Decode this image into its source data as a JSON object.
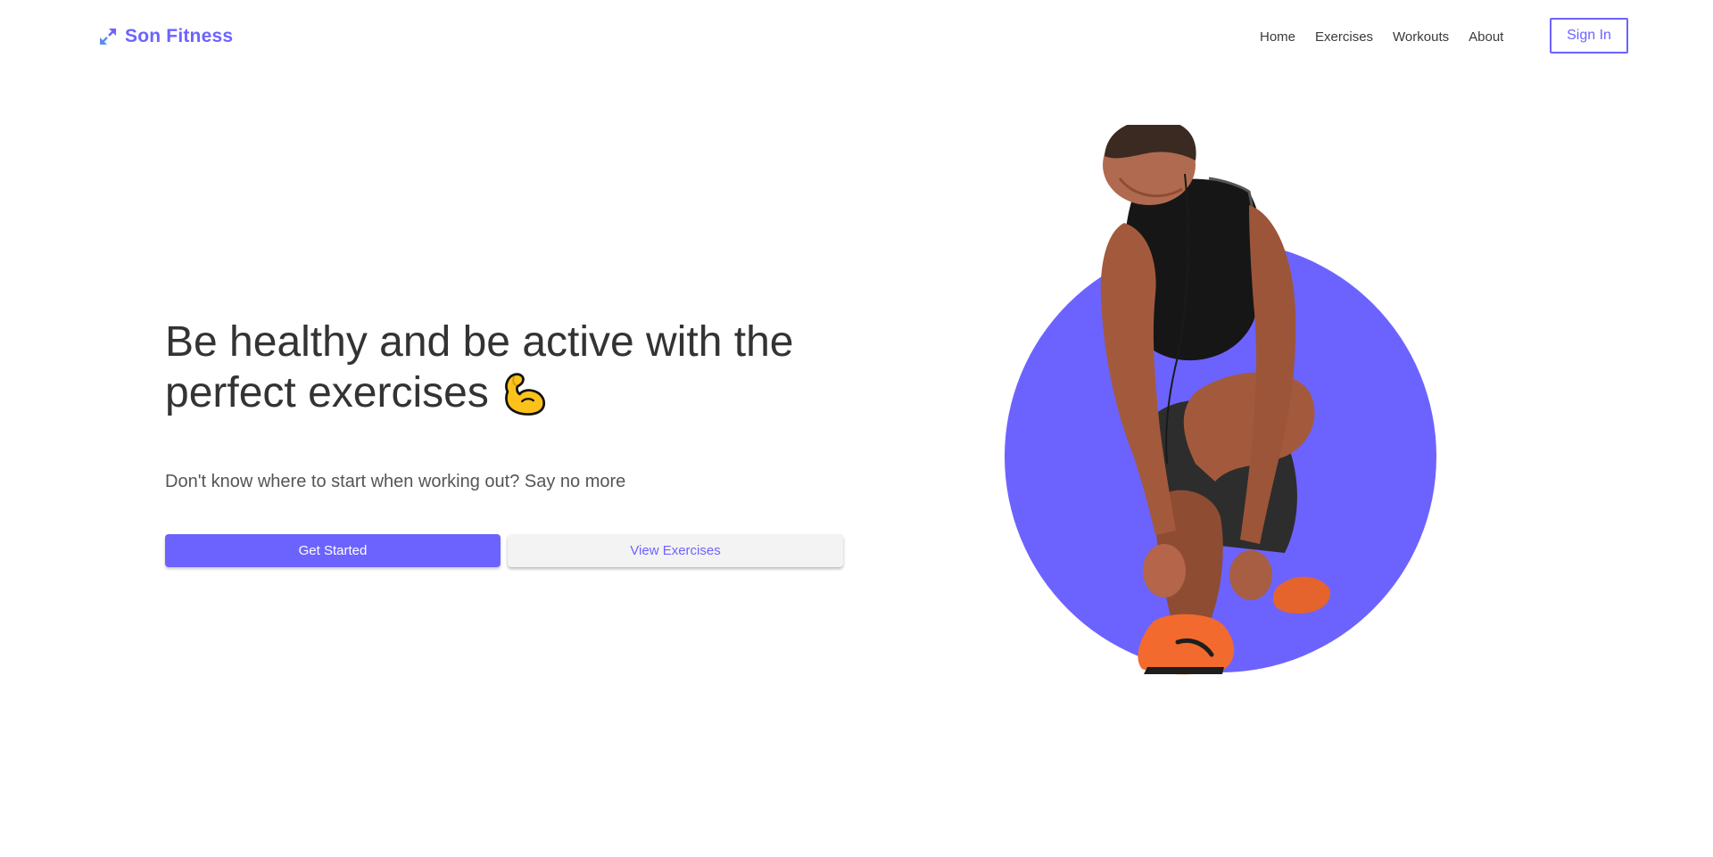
{
  "brand": {
    "name": "Son Fitness",
    "icon": "arrows-expand-icon",
    "color": "#6c63ff"
  },
  "nav": {
    "links": [
      "Home",
      "Exercises",
      "Workouts",
      "About"
    ],
    "signin_label": "Sign In"
  },
  "hero": {
    "title": "Be healthy and be active with the perfect exercises",
    "title_emoji": "flexed-biceps-icon",
    "subtitle": "Don't know where to start when working out? Say no more",
    "primary_button": "Get Started",
    "secondary_button": "View Exercises",
    "image": "athlete-tying-shoe-image"
  },
  "colors": {
    "accent": "#6c63ff",
    "text": "#333333",
    "secondary_button_bg": "#f4f3f3",
    "shoe_orange": "#f26a2e"
  }
}
